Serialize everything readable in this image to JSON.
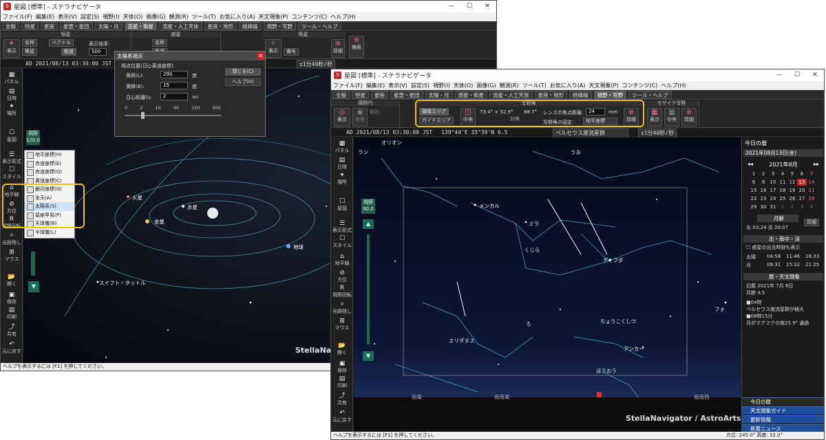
{
  "win1": {
    "title": "星図 [標準] - ステラナビゲータ",
    "menus": [
      "ファイル(F)",
      "編集(E)",
      "表示(V)",
      "設定(S)",
      "視野(I)",
      "天体(O)",
      "画像(G)",
      "観測(R)",
      "ツール(T)",
      "お気に入り(A)",
      "天文現象(P)",
      "コンテンツ(C)",
      "ヘルプ(H)"
    ],
    "tabs": [
      "全般",
      "恒星",
      "星座",
      "星雲・星団",
      "太陽・月",
      "惑星・衛星",
      "流星・人工天体",
      "星座・地形",
      "経緯線",
      "視野・写野",
      "ツール・ヘルプ"
    ],
    "ribbon": {
      "g1": "恒星",
      "g2": "惑星",
      "g3": "衛星",
      "show": "表示",
      "name": "名称",
      "mag": "等級",
      "vector": "ベクトル",
      "orbit": "軌道",
      "scale": "表示倍率:",
      "scale_val": "500",
      "number": "番号",
      "detail": "詳細",
      "search": "検索",
      "name2": "名称",
      "orbit2": "軌道"
    },
    "status": "AD 2021/08/13 03:30:00 JST",
    "rate": "±1分40秒/秒",
    "side": [
      "パネル",
      "日時",
      "場所",
      "星図",
      "表示形式",
      "スタイル",
      "地平線",
      "方位",
      "視野回転",
      "光跡残し",
      "マウス",
      "開く",
      "保存",
      "印刷",
      "共有",
      "元に戻す"
    ],
    "fov": {
      "label": "視野",
      "value": "120.0"
    },
    "menu_items": [
      "地平座標(H)",
      "赤道座標(E)",
      "赤道座標(Q)",
      "黄道座標(C)",
      "銀河座標(G)",
      "全天(A)",
      "太陽系(S)",
      "星座早見(P)",
      "天球儀(B)",
      "半球儀(L)"
    ],
    "planets": {
      "mars": "火星",
      "mercury": "水星",
      "venus": "金星",
      "earth": "地球",
      "comet": "スイフト・タットル"
    },
    "brand": "StellaNavigator / AstroArts",
    "help": "ヘルプを表示するには [F1] を押してください。",
    "dialog": {
      "title": "太陽系視点",
      "heading": "視点位置(日心黄道座標):",
      "lon_label": "黄経(L):",
      "lon": "290",
      "lat_label": "黄緯(B):",
      "lat": "15",
      "dist_label": "日心距離(I):",
      "dist": "2",
      "deg": "度",
      "au": "au",
      "ticks": [
        "0",
        "2",
        "10",
        "40",
        "150",
        "500"
      ],
      "close": "閉じる(C)",
      "help_btn": "ヘルプ(H)"
    }
  },
  "win2": {
    "title": "星図 [標準] - ステラナビゲータ",
    "menus": [
      "ファイル(F)",
      "編集(E)",
      "表示(V)",
      "設定(S)",
      "視野(I)",
      "天体(O)",
      "画像(G)",
      "観測(R)",
      "ツール(T)",
      "お気に入り(A)",
      "天文現象(P)",
      "コンテンツ(C)",
      "ヘルプ(H)"
    ],
    "tabs": [
      "全般",
      "恒星",
      "星座",
      "星雲・星団",
      "太陽・月",
      "惑星・衛星",
      "流星・人工天体",
      "星座・地形",
      "経緯線",
      "視野・写野",
      "ツール・ヘルプ"
    ],
    "ribbon": {
      "g1": "視野円",
      "g2": "写野角",
      "g3": "モザイク写野",
      "show": "表示",
      "range": "範囲:",
      "center": "中央",
      "imaging": "撮像エリア",
      "guide": "ガイドエリア",
      "dims": "73.4° × 52.9°",
      "diag_label": "対角",
      "diag": "88.7°",
      "focal_label": "レンズの焦点距離:",
      "focal": "24",
      "mm": "mm",
      "fix_label": "写野角の固定:",
      "fix_val": "地平座標",
      "detail": "詳細",
      "show2": "表示",
      "center2": "中央",
      "detail2": "詳細"
    },
    "status": "AD 2021/08/13 03:30:00 JST",
    "coords": "139°44'E 35°39'N  6.5",
    "shower": "ペルセウス座流星群",
    "rate": "±1分40秒/秒",
    "side": [
      "パネル",
      "日時",
      "場所",
      "星図",
      "表示形式",
      "スタイル",
      "地平線",
      "方位",
      "視野回転",
      "光跡残し",
      "マウス",
      "開く",
      "保存",
      "印刷",
      "共有",
      "元に戻す"
    ],
    "fov": {
      "label": "視野",
      "value": "90.0"
    },
    "constellations": {
      "orion": "オリオン",
      "uo": "うお",
      "menkar": "メンカル",
      "mira": "ミラ",
      "kujira": "くじら",
      "diphda": "ディフダ",
      "ro": "ろ",
      "eridanus": "エリダヌス",
      "chokokushitsu": "ちょうこくしつ",
      "ankaa": "アンカー",
      "hououza": "ほうおう",
      "formal": "フォ",
      "ran": "ラン"
    },
    "horizon": {
      "se": "南東",
      "sse": "南南東",
      "ssw": "南南西"
    },
    "brand": "StellaNavigator / AstroArts",
    "help": "ヘルプを表示するには [F1] を押してください。",
    "bottom_status": "方位: 245.0°  高度: 32.0°",
    "panel": {
      "title": "今日の暦",
      "date": "2021年08月13日(金)",
      "month": "2021年8月",
      "days": [
        "1",
        "2",
        "3",
        "4",
        "5",
        "6",
        "7",
        "8",
        "9",
        "10",
        "11",
        "12",
        "13",
        "14",
        "15",
        "16",
        "17",
        "18",
        "19",
        "20",
        "21",
        "22",
        "23",
        "24",
        "25",
        "26",
        "27",
        "28",
        "29",
        "30",
        "31",
        "1",
        "2",
        "3",
        "4"
      ],
      "moon_h": "月齢",
      "moon_age": "04.5",
      "moonrise_label": "出",
      "moonrise": "03:24",
      "moonset_label": "没",
      "moonset": "20:07",
      "detail": "詳細",
      "rise_h": "出・南中・没",
      "check": "惑星の出没時刻も表示",
      "sun": "太陽",
      "sun_times": [
        "04:58",
        "11:46",
        "18:33"
      ],
      "moon": "月",
      "moon_times": [
        "09:31",
        "15:32",
        "21:25"
      ],
      "cal_h": "暦・天文現象",
      "old_date": "旧暦 2021年 7月 6日",
      "age": "月齢 4.5",
      "ev1": "■04時",
      "ev2": "ペルセウス座流星群が極大",
      "ev3": "■08時15分",
      "ev4": "月がマクマクの南25.9° 通過",
      "nav": [
        "今日の暦",
        "天文現象ガイド",
        "更新情報",
        "新着ニュース"
      ]
    }
  }
}
